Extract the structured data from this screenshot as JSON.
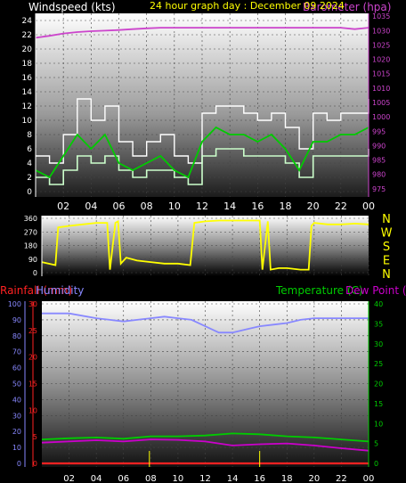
{
  "header": {
    "windspeed_label": "Windspeed (kts)",
    "graph_title": "24 hour graph day : December 09 2024",
    "barometer_label": "Barometer (hpa)"
  },
  "colors": {
    "background": "#000000",
    "wind_gust": "#ffffff",
    "wind_avg": "#ccffcc",
    "wind_trend": "#00cc00",
    "barometer": "#cc44cc",
    "direction": "#ffff00",
    "rainfall": "#ff2222",
    "humidity": "#8888ff",
    "temperature": "#00cc00",
    "dewpoint": "#cc00cc"
  },
  "chart_data": [
    {
      "type": "line",
      "panel": "wind-barometer",
      "x_tick_labels": [
        "02",
        "04",
        "06",
        "08",
        "10",
        "12",
        "14",
        "16",
        "18",
        "20",
        "22",
        "00"
      ],
      "xlim": [
        0,
        24
      ],
      "left_axis": {
        "label": "Windspeed (kts)",
        "ylim": [
          0,
          25
        ],
        "ticks": [
          0,
          2,
          4,
          6,
          8,
          10,
          12,
          14,
          16,
          18,
          20,
          22,
          24
        ]
      },
      "right_axis": {
        "label": "Barometer (hpa)",
        "ylim": [
          974,
          1036
        ],
        "ticks": [
          975,
          980,
          985,
          990,
          995,
          1000,
          1005,
          1010,
          1015,
          1020,
          1025,
          1030,
          1035
        ]
      },
      "grid": true,
      "series": [
        {
          "axis": "right",
          "x": [
            0,
            1,
            2,
            3,
            4,
            5,
            6,
            7,
            8,
            9,
            10,
            11,
            12,
            13,
            14,
            15,
            16,
            17,
            18,
            19,
            20,
            21,
            22,
            23,
            24
          ],
          "values": [
            1027.5,
            1028.2,
            1029.0,
            1029.5,
            1029.8,
            1030.0,
            1030.2,
            1030.5,
            1030.8,
            1031.0,
            1031.0,
            1031.0,
            1031.0,
            1031.0,
            1031.0,
            1031.0,
            1031.0,
            1031.0,
            1031.0,
            1031.0,
            1031.0,
            1031.0,
            1031.0,
            1030.5,
            1031.0
          ]
        },
        {
          "axis": "left",
          "x": [
            0,
            1,
            2,
            3,
            4,
            5,
            6,
            7,
            8,
            9,
            10,
            11,
            12,
            13,
            14,
            15,
            16,
            17,
            18,
            19,
            20,
            21,
            22,
            23,
            24
          ],
          "values": [
            3,
            2,
            5,
            8,
            6,
            8,
            4,
            3,
            4,
            5,
            3,
            2,
            7,
            9,
            8,
            8,
            7,
            8,
            6,
            3,
            7,
            7,
            8,
            8,
            9
          ]
        },
        {
          "axis": "left",
          "x": [
            0,
            1,
            2,
            3,
            4,
            5,
            6,
            7,
            8,
            9,
            10,
            11,
            12,
            13,
            14,
            15,
            16,
            17,
            18,
            19,
            20,
            21,
            22,
            23,
            24
          ],
          "values": [
            2,
            1,
            3,
            5,
            4,
            5,
            3,
            2,
            3,
            3,
            2,
            1,
            5,
            6,
            6,
            5,
            5,
            5,
            4,
            2,
            5,
            5,
            5,
            5,
            6
          ]
        },
        {
          "axis": "left",
          "x": [
            0,
            1,
            2,
            3,
            4,
            5,
            6,
            7,
            8,
            9,
            10,
            11,
            12,
            13,
            14,
            15,
            16,
            17,
            18,
            19,
            20,
            21,
            22,
            23,
            24
          ],
          "values": [
            5,
            4,
            8,
            13,
            10,
            12,
            7,
            5,
            7,
            8,
            5,
            4,
            11,
            12,
            12,
            11,
            10,
            11,
            9,
            6,
            11,
            10,
            11,
            11,
            13
          ]
        }
      ]
    },
    {
      "type": "line",
      "panel": "wind-direction",
      "x_tick_labels": [
        "02",
        "04",
        "06",
        "08",
        "10",
        "12",
        "14",
        "16",
        "18",
        "20",
        "22",
        "00"
      ],
      "xlim": [
        0,
        24
      ],
      "left_axis": {
        "ylim": [
          0,
          360
        ],
        "ticks": [
          0,
          90,
          180,
          270,
          360
        ]
      },
      "compass_labels": [
        "N",
        "W",
        "S",
        "E",
        "N"
      ],
      "grid": true,
      "series": [
        {
          "x": [
            0,
            1.0,
            1.2,
            2,
            3,
            4,
            4.8,
            5.0,
            5.4,
            5.6,
            5.8,
            6.2,
            7,
            8,
            9,
            10,
            10.9,
            11.2,
            12,
            13,
            14,
            15,
            16.0,
            16.2,
            16.6,
            16.8,
            17.4,
            18,
            19,
            19.6,
            19.8,
            20,
            21,
            22,
            23,
            24
          ],
          "values": [
            70,
            50,
            300,
            310,
            320,
            330,
            330,
            20,
            330,
            340,
            60,
            100,
            80,
            70,
            60,
            60,
            50,
            330,
            340,
            345,
            345,
            345,
            345,
            20,
            340,
            20,
            30,
            30,
            20,
            20,
            310,
            330,
            320,
            320,
            325,
            320
          ]
        }
      ]
    },
    {
      "type": "line",
      "panel": "rain-humidity-temperature",
      "x_tick_labels": [
        "02",
        "04",
        "06",
        "08",
        "10",
        "12",
        "14",
        "16",
        "18",
        "20",
        "22",
        "00"
      ],
      "xlim": [
        0,
        24
      ],
      "axes": {
        "rainfall": {
          "label": "Rainfall (mm)",
          "ylim": [
            0,
            30
          ],
          "ticks": [
            0,
            5,
            10,
            15,
            20,
            25,
            30
          ]
        },
        "humidity": {
          "label": "Humidity",
          "ylim": [
            0,
            100
          ],
          "ticks": [
            0,
            10,
            20,
            30,
            40,
            50,
            60,
            70,
            80,
            90,
            100
          ]
        },
        "temperature": {
          "label": "Temperature (C)",
          "ylim": [
            0,
            40
          ],
          "ticks": [
            0,
            5,
            10,
            15,
            20,
            25,
            30,
            35,
            40
          ]
        },
        "dewpoint_label": "Dew Point (C)"
      },
      "grid": true,
      "series": [
        {
          "axis": "humidity",
          "x": [
            0,
            2,
            4,
            5,
            6,
            7,
            8,
            9,
            10,
            11,
            12,
            13,
            14,
            15,
            16,
            17,
            18,
            19,
            20,
            21,
            22,
            23,
            24
          ],
          "values": [
            94,
            94,
            91,
            90,
            89,
            90,
            91,
            92,
            91,
            90,
            86,
            82,
            82,
            84,
            86,
            87,
            88,
            90,
            91,
            91,
            91,
            91,
            91
          ]
        },
        {
          "axis": "temperature",
          "x": [
            0,
            2,
            4,
            6,
            8,
            10,
            12,
            14,
            16,
            18,
            20,
            22,
            24
          ],
          "values": [
            6.0,
            6.3,
            6.5,
            6.2,
            6.8,
            6.8,
            7.0,
            7.5,
            7.3,
            6.8,
            6.5,
            6.0,
            5.5
          ]
        },
        {
          "axis": "temperature",
          "x": [
            0,
            2,
            4,
            6,
            8,
            10,
            12,
            14,
            16,
            18,
            20,
            22,
            24
          ],
          "values": [
            5.2,
            5.5,
            5.8,
            5.5,
            6.0,
            5.9,
            5.5,
            4.5,
            4.8,
            5.0,
            4.5,
            3.8,
            3.2
          ]
        },
        {
          "axis": "rainfall",
          "x": [
            0,
            24
          ],
          "values": [
            0,
            0
          ]
        }
      ]
    }
  ]
}
